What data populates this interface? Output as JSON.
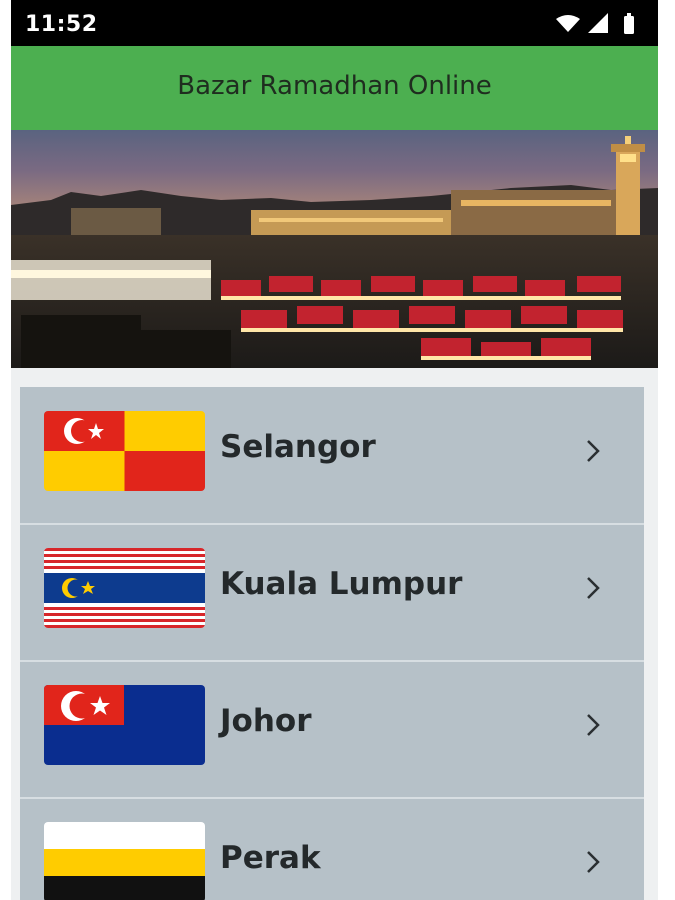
{
  "status_bar": {
    "time": "11:52",
    "icons": [
      "wifi-icon",
      "cell-signal-icon",
      "battery-icon"
    ]
  },
  "app_bar": {
    "title": "Bazar Ramadhan Online",
    "color": "#4caf50"
  },
  "banner": {
    "image": "night-market-banner"
  },
  "states": [
    {
      "label": "Selangor",
      "flag": "selangor-flag-icon"
    },
    {
      "label": "Kuala Lumpur",
      "flag": "kuala-lumpur-flag-icon"
    },
    {
      "label": "Johor",
      "flag": "johor-flag-icon"
    },
    {
      "label": "Perak",
      "flag": "perak-flag-icon"
    }
  ],
  "colors": {
    "list_background": "#b6c1c8",
    "row_text": "#24292b"
  }
}
